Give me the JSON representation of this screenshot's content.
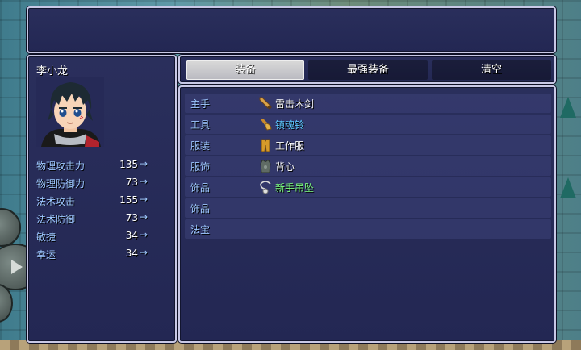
{
  "actor": {
    "name": "李小龙"
  },
  "params": [
    {
      "name": "物理攻击力",
      "value": "135",
      "arrow": "→"
    },
    {
      "name": "物理防御力",
      "value": "73",
      "arrow": "→"
    },
    {
      "name": "法术攻击",
      "value": "155",
      "arrow": "→"
    },
    {
      "name": "法术防御",
      "value": "73",
      "arrow": "→"
    },
    {
      "name": "敏捷",
      "value": "34",
      "arrow": "→"
    },
    {
      "name": "幸运",
      "value": "34",
      "arrow": "→"
    }
  ],
  "commands": {
    "equip": "装备",
    "optimize": "最强装备",
    "clear": "清空"
  },
  "slots": [
    {
      "slot": "主手",
      "item": "雷击木剑",
      "color": "#ffffff",
      "icon": "sword-icon"
    },
    {
      "slot": "工具",
      "item": "镇魂铃",
      "color": "#5cc8ff",
      "icon": "bell-icon"
    },
    {
      "slot": "服装",
      "item": "工作服",
      "color": "#ffffff",
      "icon": "clothes-icon"
    },
    {
      "slot": "服饰",
      "item": "背心",
      "color": "#ffffff",
      "icon": "vest-icon"
    },
    {
      "slot": "饰品",
      "item": "新手吊坠",
      "color": "#7cff7c",
      "icon": "pendant-icon"
    },
    {
      "slot": "饰品",
      "item": "",
      "color": "#ffffff",
      "icon": ""
    },
    {
      "slot": "法宝",
      "item": "",
      "color": "#ffffff",
      "icon": ""
    }
  ],
  "colors": {
    "window": "#262a57",
    "border": "#c8c8e6",
    "system": "#9ec8ff"
  }
}
